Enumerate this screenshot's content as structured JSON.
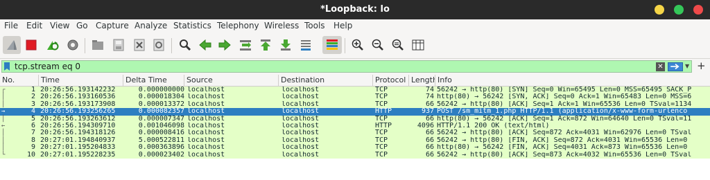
{
  "window": {
    "title": "*Loopback: lo"
  },
  "menu": [
    "File",
    "Edit",
    "View",
    "Go",
    "Capture",
    "Analyze",
    "Statistics",
    "Telephony",
    "Wireless",
    "Tools",
    "Help"
  ],
  "toolbar": {
    "icons": [
      "shark-fin-start-icon",
      "stop-square-icon",
      "restart-capture-icon",
      "capture-options-gear-icon",
      "open-file-icon",
      "save-file-icon",
      "close-file-icon",
      "reload-file-icon",
      "find-packet-magnifier-icon",
      "go-back-arrow-icon",
      "go-forward-arrow-icon",
      "go-to-packet-icon",
      "go-first-packet-icon",
      "go-last-packet-icon",
      "auto-scroll-icon",
      "colorize-icon",
      "zoom-in-icon",
      "zoom-out-icon",
      "normal-size-icon",
      "resize-columns-icon"
    ]
  },
  "filter": {
    "value": "tcp.stream eq 0",
    "color": "#aff7b1"
  },
  "packet_list": {
    "columns": [
      "No.",
      "Time",
      "Delta Time",
      "Source",
      "Destination",
      "Protocol",
      "Length",
      "Info"
    ],
    "rows": [
      {
        "no": "1",
        "time": "20:26:56.193142232",
        "delta": "0.000000000",
        "src": "localhost",
        "dst": "localhost",
        "proto": "TCP",
        "len": "74",
        "info": "56242 → http(80) [SYN] Seq=0 Win=65495 Len=0 MSS=65495 SACK_P",
        "rel": "┌"
      },
      {
        "no": "2",
        "time": "20:26:56.193160536",
        "delta": "0.000018304",
        "src": "localhost",
        "dst": "localhost",
        "proto": "TCP",
        "len": "74",
        "info": "http(80) → 56242 [SYN, ACK] Seq=0 Ack=1 Win=65483 Len=0 MSS=6",
        "rel": "│"
      },
      {
        "no": "3",
        "time": "20:26:56.193173908",
        "delta": "0.000013372",
        "src": "localhost",
        "dst": "localhost",
        "proto": "TCP",
        "len": "66",
        "info": "56242 → http(80) [ACK] Seq=1 Ack=1 Win=65536 Len=0 TSval=1134",
        "rel": "│"
      },
      {
        "no": "4",
        "time": "20:26:56.193256265",
        "delta": "0.000082357",
        "src": "localhost",
        "dst": "localhost",
        "proto": "HTTP",
        "len": "937",
        "info": "POST /sm_mitm_1.php HTTP/1.1  (application/x-www-form-urlenco",
        "rel": "→",
        "selected": true
      },
      {
        "no": "5",
        "time": "20:26:56.193263612",
        "delta": "0.000007347",
        "src": "localhost",
        "dst": "localhost",
        "proto": "TCP",
        "len": "66",
        "info": "http(80) → 56242 [ACK] Seq=1 Ack=872 Win=64640 Len=0 TSval=11",
        "rel": "│"
      },
      {
        "no": "6",
        "time": "20:26:56.194309710",
        "delta": "0.001046098",
        "src": "localhost",
        "dst": "localhost",
        "proto": "HTTP",
        "len": "4096",
        "info": "HTTP/1.1 200 OK  (text/html)",
        "rel": "←"
      },
      {
        "no": "7",
        "time": "20:26:56.194318126",
        "delta": "0.000008416",
        "src": "localhost",
        "dst": "localhost",
        "proto": "TCP",
        "len": "66",
        "info": "56242 → http(80) [ACK] Seq=872 Ack=4031 Win=62976 Len=0 TSval",
        "rel": "│"
      },
      {
        "no": "8",
        "time": "20:27:01.194840937",
        "delta": "5.000522811",
        "src": "localhost",
        "dst": "localhost",
        "proto": "TCP",
        "len": "66",
        "info": "56242 → http(80) [FIN, ACK] Seq=872 Ack=4031 Win=65536 Len=0",
        "rel": "│"
      },
      {
        "no": "9",
        "time": "20:27:01.195204833",
        "delta": "0.000363896",
        "src": "localhost",
        "dst": "localhost",
        "proto": "TCP",
        "len": "66",
        "info": "http(80) → 56242 [FIN, ACK] Seq=4031 Ack=873 Win=65536 Len=0",
        "rel": "│"
      },
      {
        "no": "10",
        "time": "20:27:01.195228235",
        "delta": "0.000023402",
        "src": "localhost",
        "dst": "localhost",
        "proto": "TCP",
        "len": "66",
        "info": "56242 → http(80) [ACK] Seq=873 Ack=4032 Win=65536 Len=0 TSval",
        "rel": "└"
      }
    ],
    "row_color": "#e4ffc7",
    "selected_color": "#2d7ec1"
  }
}
